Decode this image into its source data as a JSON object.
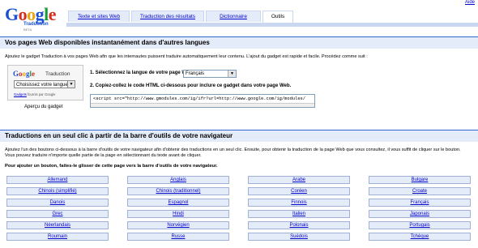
{
  "header": {
    "help_link": "Aide",
    "logo": {
      "wordmark": [
        "G",
        "o",
        "o",
        "g",
        "l",
        "e"
      ],
      "product": "Traduction",
      "badge": "BETA"
    },
    "tabs": [
      {
        "label": "Texte et sites Web",
        "active": false
      },
      {
        "label": "Traduction des résultats",
        "active": false
      },
      {
        "label": "Dictionnaire",
        "active": false
      },
      {
        "label": "Outils",
        "active": true
      }
    ]
  },
  "section1": {
    "title": "Vos pages Web disponibles instantanément dans d'autres langues",
    "intro": "Ajoutez le gadget Traduction à vos pages Web afin que les internautes puissent traduire automatiquement leur contenu. L'ajout du gadget est rapide et facile. Procédez comme suit :",
    "gadget": {
      "label": "Traduction",
      "select_value": "Choisissez votre langue",
      "footer_link": "Gadgets",
      "footer_text": "fournis par Google",
      "caption": "Aperçu du gadget"
    },
    "step1": "1.  Sélectionnez la langue de votre page Web :",
    "step1_selected": "Français",
    "step2": "2.  Copiez-collez le code HTML ci-dessous pour inclure ce gadget dans votre page Web.",
    "code": "<script src=\"http://www.gmodules.com/ig/ifr?url=http://www.google.com/ig/modules/"
  },
  "section2": {
    "title": "Traductions en un seul clic à partir de la barre d'outils de votre navigateur",
    "intro": "Ajoutez l'un des boutons ci-dessous à la barre d'outils de votre navigateur afin d'obtenir des traductions en un seul clic. Ensuite, pour obtenir la traduction de la page Web que vous consultez, il vous suffit de cliquer sur le bouton. Vous pouvez traduire n'importe quelle partie de la page en sélectionnant du texte avant de cliquer.",
    "instruction": "Pour ajouter un bouton, faites-le glisser de cette page vers la barre d'outils de votre navigateur.",
    "buttons": [
      [
        "Allemand",
        "Anglais",
        "Arabe",
        "Bulgare"
      ],
      [
        "Chinois (simplifié)",
        "Chinois (traditionnel)",
        "Coréen",
        "Croate"
      ],
      [
        "Danois",
        "Espagnol",
        "Finnois",
        "Français"
      ],
      [
        "Grec",
        "Hindi",
        "Italien",
        "Japonais"
      ],
      [
        "Néerlandais",
        "Norvégien",
        "Polonais",
        "Portugais"
      ],
      [
        "Roumain",
        "Russe",
        "Suédois",
        "Tchèque"
      ]
    ]
  }
}
